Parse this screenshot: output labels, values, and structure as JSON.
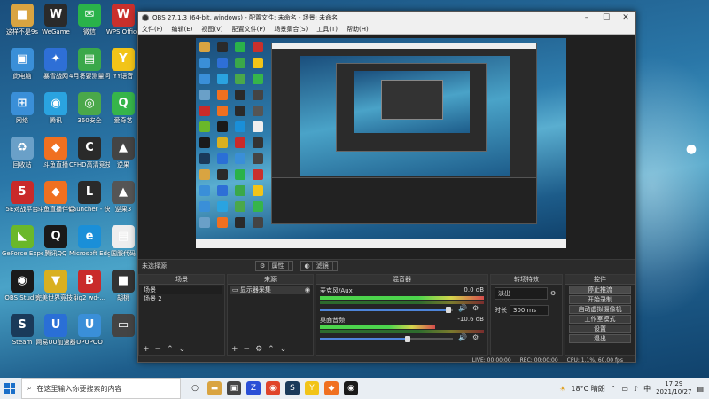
{
  "desktop": {
    "icons_left": [
      {
        "label": "这样不是9s",
        "color": "#d9a441",
        "glyph": "■"
      },
      {
        "label": "WeGame",
        "color": "#2a2a2a",
        "glyph": "W"
      },
      {
        "label": "微信",
        "color": "#2ab24a",
        "glyph": "✉"
      },
      {
        "label": "WPS Office",
        "color": "#c9302c",
        "glyph": "W"
      },
      {
        "label": "此电脑",
        "color": "#3a8fd8",
        "glyph": "▣"
      },
      {
        "label": "暴雪战网",
        "color": "#2e6fd6",
        "glyph": "✦"
      },
      {
        "label": "4月将要测量问题（1）",
        "color": "#3aa84a",
        "glyph": "▤"
      },
      {
        "label": "YY语音",
        "color": "#f2c418",
        "glyph": "Y"
      },
      {
        "label": "网络",
        "color": "#3a8fd8",
        "glyph": "⊞"
      },
      {
        "label": "腾讯",
        "color": "#2aa3e0",
        "glyph": "◉"
      },
      {
        "label": "360安全",
        "color": "#4aa84a",
        "glyph": "◎"
      },
      {
        "label": "爱奇艺",
        "color": "#36b54a",
        "glyph": "Q"
      },
      {
        "label": "回收站",
        "color": "#6aa0c8",
        "glyph": "♻"
      },
      {
        "label": "斗鱼直播",
        "color": "#f07020",
        "glyph": "◆"
      },
      {
        "label": "CFHD高清竞技大区",
        "color": "#2a2a2a",
        "glyph": "C"
      },
      {
        "label": "逆果",
        "color": "#444",
        "glyph": "▲"
      },
      {
        "label": "5E对战平台",
        "color": "#c92a2a",
        "glyph": "5"
      },
      {
        "label": "斗鱼直播伴侣",
        "color": "#f07020",
        "glyph": "◆"
      },
      {
        "label": "Launcher - 快捷方式",
        "color": "#2a2a2a",
        "glyph": "L"
      },
      {
        "label": "逆果3",
        "color": "#555",
        "glyph": "▲"
      },
      {
        "label": "GeForce Experience",
        "color": "#6ab82a",
        "glyph": "◣"
      },
      {
        "label": "腾讯QQ",
        "color": "#1a1a1a",
        "glyph": "Q"
      },
      {
        "label": "Microsoft Edge",
        "color": "#1a8fd8",
        "glyph": "e"
      },
      {
        "label": "国服代码",
        "color": "#eee",
        "glyph": "▤"
      },
      {
        "label": "OBS Studio",
        "color": "#1a1a1a",
        "glyph": "◉"
      },
      {
        "label": "完美世界竞技平台",
        "color": "#d9b020",
        "glyph": "▼"
      },
      {
        "label": "sig2 wd-...",
        "color": "#c92a2a",
        "glyph": "B"
      },
      {
        "label": "胡桃",
        "color": "#333",
        "glyph": "■"
      },
      {
        "label": "Steam",
        "color": "#1a3a5a",
        "glyph": "S"
      },
      {
        "label": "网易UU加速器",
        "color": "#2a6fd6",
        "glyph": "U"
      },
      {
        "label": "UPUPOO",
        "color": "#3a8fd8",
        "glyph": "U"
      },
      {
        "label": "",
        "color": "#444",
        "glyph": "▭"
      }
    ]
  },
  "window": {
    "title": "OBS 27.1.3 (64-bit, windows) - 配置文件: 未命名 - 场景: 未命名",
    "menu": [
      "文件(F)",
      "编辑(E)",
      "视图(V)",
      "配置文件(P)",
      "场景集合(S)",
      "工具(T)",
      "帮助(H)"
    ],
    "minimize": "–",
    "maximize": "☐",
    "close": "✕"
  },
  "source_toolbar": {
    "label": "未选择源",
    "properties": "属性",
    "filters": "滤镜"
  },
  "docks": {
    "scenes": {
      "header": "场景",
      "items": [
        "场景",
        "场景 2"
      ]
    },
    "sources": {
      "header": "来源",
      "items": [
        "显示器采集"
      ]
    },
    "mixer": {
      "header": "混音器",
      "tracks": [
        {
          "name": "麦克风/Aux",
          "db": "0.0 dB",
          "level": 0.85
        },
        {
          "name": "桌面音频",
          "db": "-10.6 dB",
          "level": 0.6
        }
      ]
    },
    "transitions": {
      "header": "转场特效",
      "type": "淡出",
      "duration_label": "时长",
      "duration": "300 ms"
    },
    "controls": {
      "header": "控件",
      "buttons": [
        "停止推流",
        "开始录制",
        "启动虚拟摄像机",
        "工作室模式",
        "设置",
        "退出"
      ]
    }
  },
  "status": {
    "live": "LIVE: 00:00:00",
    "rec": "REC: 00:00:00",
    "cpu": "CPU: 1.1%, 60.00 fps"
  },
  "taskbar": {
    "search_placeholder": "在这里输入你要搜索的内容",
    "weather": "18°C 晴朗",
    "time": "17:29",
    "date": "2021/10/27"
  }
}
